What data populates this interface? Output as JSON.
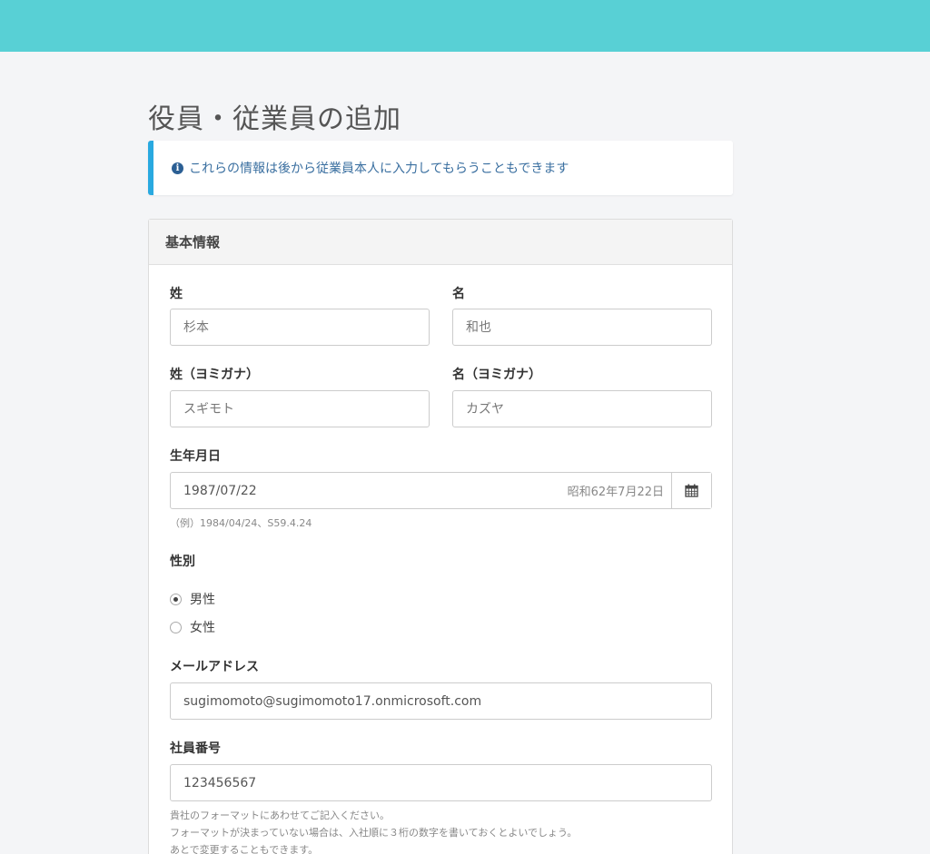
{
  "page": {
    "title": "役員・従業員の追加",
    "notice": "これらの情報は後から従業員本人に入力してもらうこともできます"
  },
  "panel": {
    "heading": "基本情報",
    "last_name": {
      "label": "姓",
      "value": "杉本"
    },
    "first_name": {
      "label": "名",
      "value": "和也"
    },
    "last_name_kana": {
      "label": "姓（ヨミガナ）",
      "value": "スギモト"
    },
    "first_name_kana": {
      "label": "名（ヨミガナ）",
      "value": "カズヤ"
    },
    "birthday": {
      "label": "生年月日",
      "value": "1987/07/22",
      "era": "昭和62年7月22日",
      "hint": "（例）1984/04/24、S59.4.24"
    },
    "gender": {
      "label": "性別",
      "options": [
        "男性",
        "女性"
      ],
      "selected": "男性"
    },
    "email": {
      "label": "メールアドレス",
      "value": "sugimomoto@sugimomoto17.onmicrosoft.com"
    },
    "employee_number": {
      "label": "社員番号",
      "value": "123456567",
      "hint_lines": [
        "貴社のフォーマットにあわせてご記入ください。",
        "フォーマットが決まっていない場合は、入社順に３桁の数字を書いておくとよいでしょう。",
        "あとで変更することもできます。"
      ]
    }
  },
  "colors": {
    "header": "#58d0d5",
    "accent": "#29a9e0"
  },
  "icons": {
    "notice": "info-circle-icon",
    "birthday": "calendar-icon"
  }
}
